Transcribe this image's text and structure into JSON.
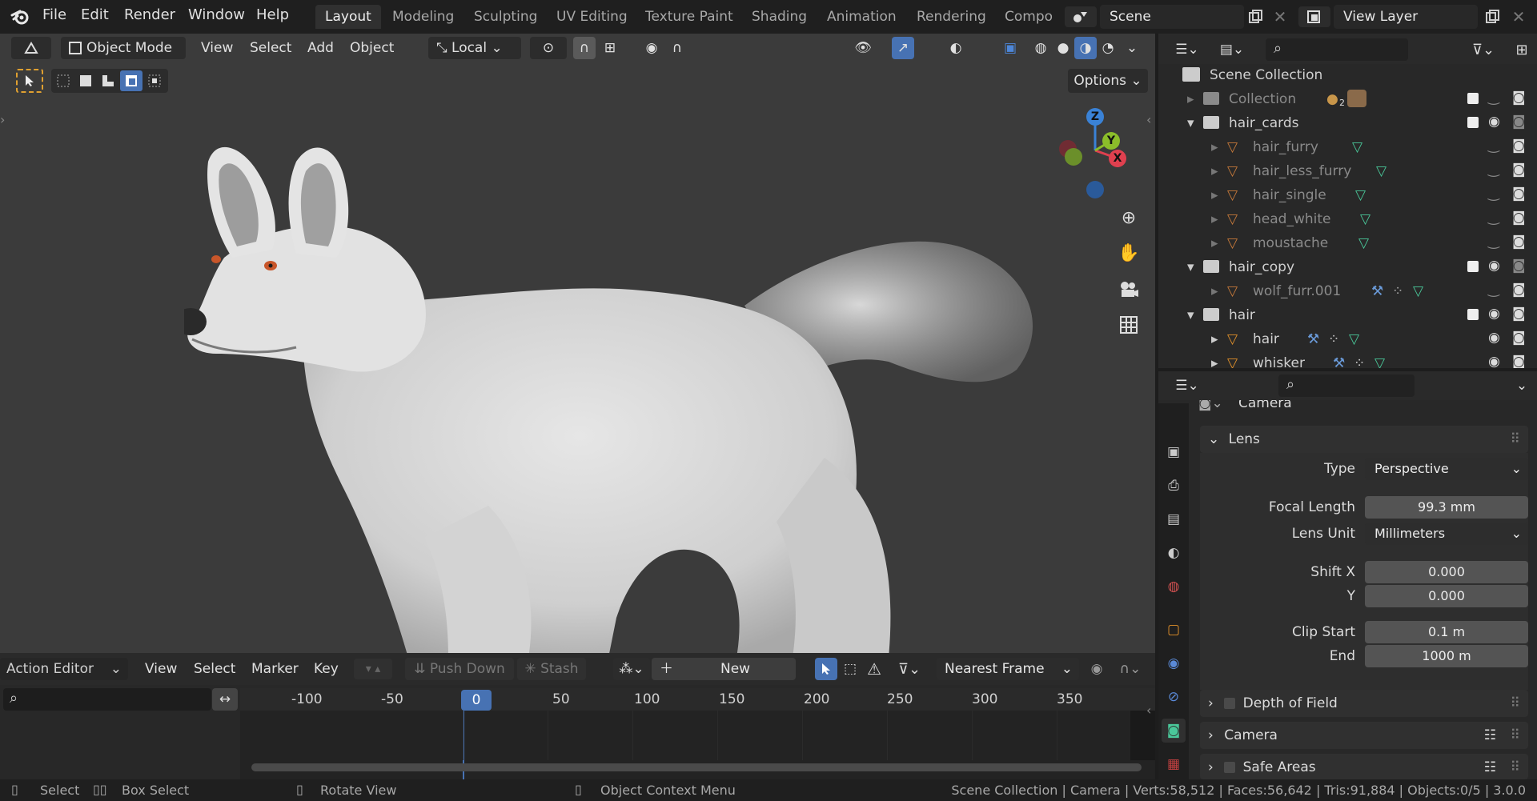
{
  "topbar": {
    "menus": [
      "File",
      "Edit",
      "Render",
      "Window",
      "Help"
    ],
    "workspaces": [
      "Layout",
      "Modeling",
      "Sculpting",
      "UV Editing",
      "Texture Paint",
      "Shading",
      "Animation",
      "Rendering",
      "Compo"
    ],
    "active_workspace": "Layout",
    "scene": "Scene",
    "view_layer": "View Layer"
  },
  "viewport": {
    "mode": "Object Mode",
    "menus": [
      "View",
      "Select",
      "Add",
      "Object"
    ],
    "transform_orientation": "Local",
    "options": "Options",
    "gizmo": {
      "z": "Z",
      "y": "Y",
      "x": "X"
    }
  },
  "action_editor": {
    "editor": "Action Editor",
    "menus": [
      "View",
      "Select",
      "Marker",
      "Key"
    ],
    "push_down": "Push Down",
    "stash": "Stash",
    "new": "New",
    "snap": "Nearest Frame",
    "current_frame": "0",
    "ticks": [
      "-100",
      "-50",
      "50",
      "100",
      "150",
      "200",
      "250",
      "300",
      "350"
    ]
  },
  "status": {
    "select": "Select",
    "box_select": "Box Select",
    "rotate": "Rotate View",
    "context": "Object Context Menu",
    "stats": "Scene Collection | Camera | Verts:58,512 | Faces:56,642 | Tris:91,884 | Objects:0/5 | 3.0.0"
  },
  "outliner": {
    "root": "Scene Collection",
    "rows": [
      {
        "label": "Collection",
        "badge": "2"
      },
      {
        "label": "hair_cards"
      },
      {
        "label": "hair_furry"
      },
      {
        "label": "hair_less_furry"
      },
      {
        "label": "hair_single"
      },
      {
        "label": "head_white"
      },
      {
        "label": "moustache"
      },
      {
        "label": "hair_copy"
      },
      {
        "label": "wolf_furr.001"
      },
      {
        "label": "hair"
      },
      {
        "label": "hair"
      },
      {
        "label": "whisker"
      }
    ]
  },
  "properties": {
    "context": "Camera",
    "lens_panel": "Lens",
    "type_label": "Type",
    "type_value": "Perspective",
    "focal_label": "Focal Length",
    "focal_value": "99.3 mm",
    "lens_unit_label": "Lens Unit",
    "lens_unit_value": "Millimeters",
    "shift_x_label": "Shift X",
    "shift_x_value": "0.000",
    "shift_y_label": "Y",
    "shift_y_value": "0.000",
    "clip_start_label": "Clip Start",
    "clip_start_value": "0.1 m",
    "clip_end_label": "End",
    "clip_end_value": "1000 m",
    "dof_panel": "Depth of Field",
    "camera_panel": "Camera",
    "safe_panel": "Safe Areas"
  },
  "colors": {
    "accent": "#4772b3",
    "viewport_bg": "#3b3b3b",
    "panel_bg": "#282828",
    "x_axis": "#e0404f",
    "y_axis": "#8bbd2a",
    "z_axis": "#3a82d6"
  }
}
